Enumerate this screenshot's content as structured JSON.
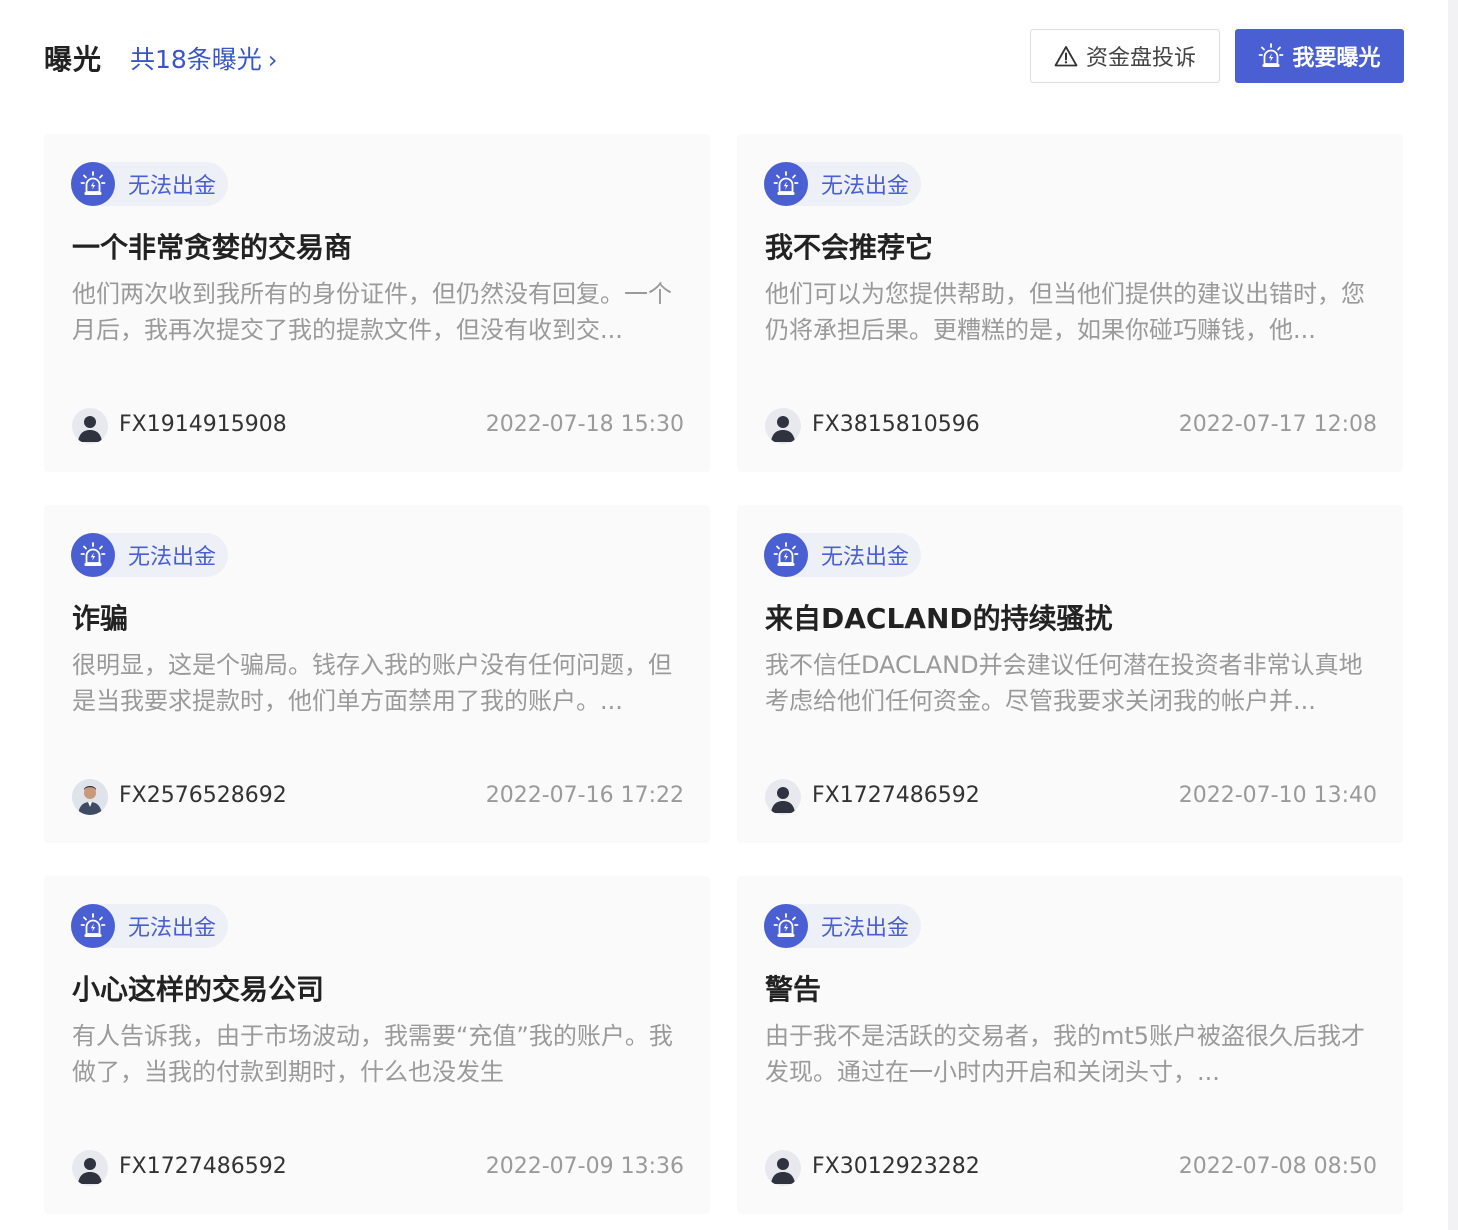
{
  "header": {
    "title": "曝光",
    "count_link": "共18条曝光",
    "complain_label": "资金盘投诉",
    "expose_label": "我要曝光"
  },
  "colors": {
    "accent": "#4a5fd1",
    "link": "#3b55c6",
    "card_bg": "#fafafb",
    "muted_text": "#9a9a9a"
  },
  "cards": [
    {
      "tag": "无法出金",
      "title": "一个非常贪婪的交易商",
      "desc": "他们两次收到我所有的身份证件，但仍然没有回复。一个月后，我再次提交了我的提款文件，但没有收到交...",
      "user": "FX1914915908",
      "time": "2022-07-18 15:30",
      "avatar": "default-avatar-icon"
    },
    {
      "tag": "无法出金",
      "title": "我不会推荐它",
      "desc": "他们可以为您提供帮助，但当他们提供的建议出错时，您仍将承担后果。更糟糕的是，如果你碰巧赚钱，他...",
      "user": "FX3815810596",
      "time": "2022-07-17 12:08",
      "avatar": "default-avatar-icon"
    },
    {
      "tag": "无法出金",
      "title": "诈骗",
      "desc": "很明显，这是个骗局。钱存入我的账户没有任何问题，但是当我要求提款时，他们单方面禁用了我的账户。...",
      "user": "FX2576528692",
      "time": "2022-07-16 17:22",
      "avatar": "photo-avatar-icon"
    },
    {
      "tag": "无法出金",
      "title": "来自DACLAND的持续骚扰",
      "desc": "我不信任DACLAND并会建议任何潜在投资者非常认真地考虑给他们任何资金。尽管我要求关闭我的帐户并...",
      "user": "FX1727486592",
      "time": "2022-07-10 13:40",
      "avatar": "default-avatar-icon"
    },
    {
      "tag": "无法出金",
      "title": "小心这样的交易公司",
      "desc": "有人告诉我，由于市场波动，我需要“充值”我的账户。我做了，当我的付款到期时，什么也没发生",
      "user": "FX1727486592",
      "time": "2022-07-09 13:36",
      "avatar": "default-avatar-icon"
    },
    {
      "tag": "无法出金",
      "title": "警告",
      "desc": "由于我不是活跃的交易者，我的mt5账户被盗很久后我才发现。通过在一小时内开启和关闭头寸，...",
      "user": "FX3012923282",
      "time": "2022-07-08 08:50",
      "avatar": "default-avatar-icon"
    }
  ]
}
